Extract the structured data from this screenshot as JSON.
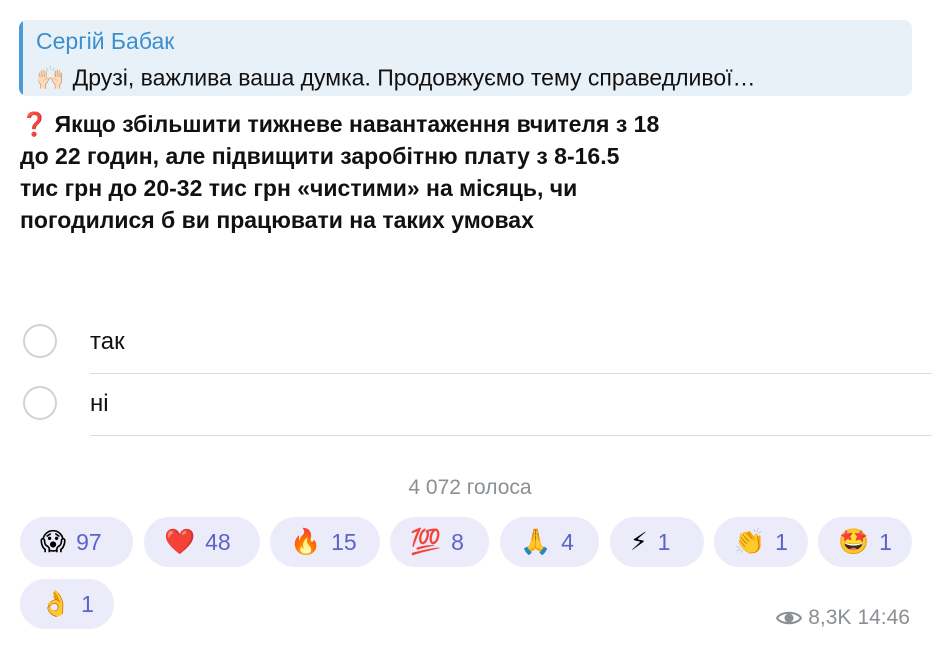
{
  "reply": {
    "author": "Сергій Бабак",
    "emoji": "🙌🏻",
    "text": "Друзі, важлива ваша думка.  Продовжуємо тему справедливої…"
  },
  "poll": {
    "question_icon": "❓",
    "question": "Якщо збільшити тижневе навантаження вчителя з 18 до 22 годин, але підвищити заробітню плату з 8-16.5 тис грн до 20-32 тис грн «чистими» на місяць, чи погодилися б ви працювати на таких умовах",
    "options": [
      {
        "label": "так"
      },
      {
        "label": "ні"
      }
    ],
    "votes_text": "4 072 голоса"
  },
  "reactions": [
    {
      "emoji": "😱",
      "count": "97"
    },
    {
      "emoji": "❤️",
      "count": "48"
    },
    {
      "emoji": "🔥",
      "count": "15"
    },
    {
      "emoji": "💯",
      "count": "8"
    },
    {
      "emoji": "🙏",
      "count": "4"
    },
    {
      "emoji": "⚡",
      "count": "1"
    },
    {
      "emoji": "👏",
      "count": "1"
    },
    {
      "emoji": "🤩",
      "count": "1"
    },
    {
      "emoji": "👌",
      "count": "1"
    }
  ],
  "meta": {
    "views": "8,3K",
    "time": "14:46",
    "icon": "eye-icon"
  },
  "colors": {
    "accent": "#3c8fcf",
    "reaction_bg": "#ecebf9",
    "reaction_count": "#5b64c8",
    "muted": "#8a8f93"
  }
}
